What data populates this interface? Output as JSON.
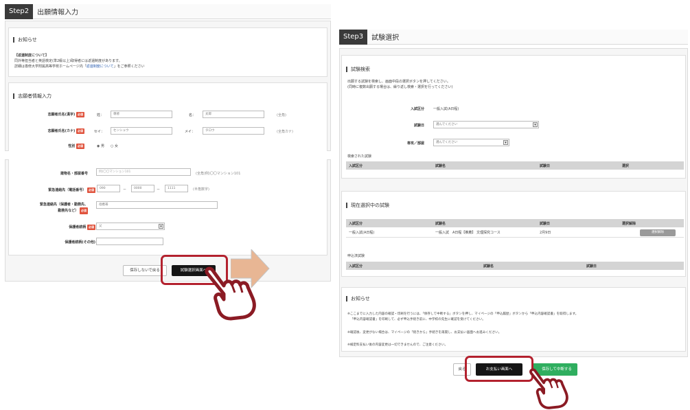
{
  "step2": {
    "badge": "Step2",
    "title": "出願情報入力",
    "notice": {
      "title": "お知らせ",
      "heading": "【返還制度について】",
      "line1": "同外等担当者と英語検定(準2級以上)取得者には返還制度があります。",
      "line2_prefix": "詳細は専修大学附属高等学校ホームページ内「",
      "line2_link": "返還制度について",
      "line2_suffix": "」をご参照ください"
    },
    "applicant": {
      "title": "志願者情報入力",
      "name_kanji_label": "志願者氏名(漢字)",
      "surname_kanji_prefix": "姓：",
      "surname_kanji_value": "専修",
      "given_kanji_prefix": "名：",
      "given_kanji_value": "太郎",
      "kanji_note": "(全角)",
      "name_kana_label": "志願者氏名(カナ)",
      "surname_kana_prefix": "セイ：",
      "surname_kana_value": "センシュウ",
      "given_kana_prefix": "メイ：",
      "given_kana_value": "タロウ",
      "kana_note": "(全角カナ)",
      "gender_label": "性別",
      "gender_male": "男",
      "gender_female": "女",
      "required": "必須"
    },
    "lower_form": {
      "building_label": "建物名・部屋番号",
      "building_placeholder": "例)〇〇マンション101",
      "building_note": "(全角)例)〇〇マンション101",
      "emergency_phone_label": "緊急連絡先（電話番号）",
      "phone1": "090",
      "phone2": "0000",
      "phone3": "1111",
      "phone_dash": "－",
      "phone_note": "(半角数字)",
      "emergency_name_label_1": "緊急連絡先（保護者・勤務先、",
      "emergency_name_label_2": "勤務先など）",
      "emergency_name_value": "母携帯",
      "guardian_rel_label": "保護者続柄",
      "guardian_rel_value": "父",
      "guardian_rel_other_label": "保護者続柄(その他)",
      "required": "必須"
    },
    "buttons": {
      "save_without": "保存しないで戻る",
      "to_exam": "試験選択画面へ"
    }
  },
  "step3": {
    "badge": "Step3",
    "title": "試験選択",
    "search": {
      "title": "試験検索",
      "desc1": "出願する試験を検索し、画面中段の選択ボタンを押してください。",
      "desc2": "(同時に複数出願する場合は、繰り返し検索・選択を行ってください)",
      "category_label": "入試区分",
      "category_value": "一般入試(A日程)",
      "date_label": "試験日",
      "date_value": "選んでください",
      "course_label": "専攻／部屋",
      "course_value": "選んでください",
      "results_label": "検索された試験",
      "columns": [
        "入試区分",
        "試験名",
        "試験日",
        "選択"
      ]
    },
    "selected": {
      "title": "現在選択中の試験",
      "columns": [
        "入試区分",
        "試験名",
        "試験日",
        "選択解除"
      ],
      "row": {
        "category": "一般入試(A日程)",
        "exam": "一般入試　A日程【推薦】 文理探究コース",
        "date": "2月9日",
        "action": "選択解除"
      },
      "applied_label": "申込済試験",
      "applied_columns": [
        "入試区分",
        "試験名",
        "試験日"
      ]
    },
    "notice": {
      "title": "お知らせ",
      "line1": "※ここまでに入力した内容の確認・印刷を行うには、「保存して中断する」ボタンを押し、マイページの「申込履歴」ボタンから「申込内容確認書」を取得します。",
      "line2": "「申込内容確認書」を印刷して、必ず申込手続き前に、中学校の先生に確認を受けてください。",
      "line3": "※確認後、変更がない場合は、マイページの「続きから」手続きを再開し、お支払い画面へお進みください。",
      "line4": "※検定料支払い後の内容変更は一切できませんので、ご注意ください。"
    },
    "buttons": {
      "back": "戻る",
      "to_payment": "お支払い画面へ",
      "save_interrupt": "保存して中断する"
    }
  },
  "colors": {
    "step_badge": "#3a3a3a",
    "required": "#e0533d",
    "highlight": "#b3212e",
    "green": "#2fae5f",
    "arrow": "#e8b694"
  },
  "icons": [
    "pointing-hand-icon",
    "right-arrow-icon",
    "select-chevron-icon"
  ]
}
